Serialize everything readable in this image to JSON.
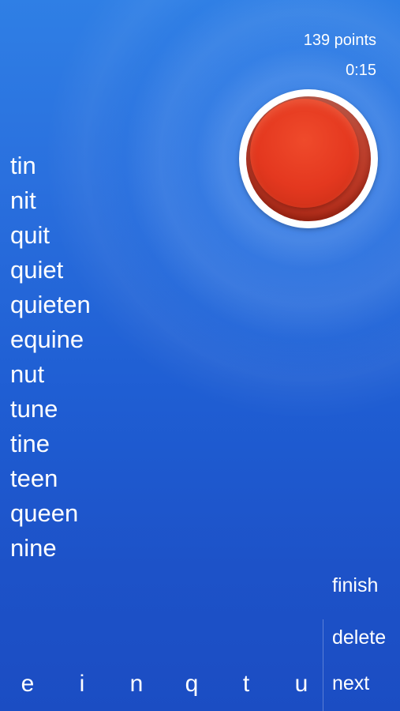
{
  "status": {
    "score": "139 points",
    "timer": "0:15"
  },
  "words": [
    "tin",
    "nit",
    "quit",
    "quiet",
    "quieten",
    "equine",
    "nut",
    "tune",
    "tine",
    "teen",
    "queen",
    "nine"
  ],
  "actions": {
    "finish": "finish",
    "delete": "delete",
    "next": "next"
  },
  "letters": [
    "e",
    "i",
    "n",
    "q",
    "t",
    "u"
  ],
  "colors": {
    "background": "#1f63d6",
    "button_red": "#e4381f",
    "text": "#ffffff"
  },
  "icons": {
    "submit_button": "red-round-button"
  }
}
